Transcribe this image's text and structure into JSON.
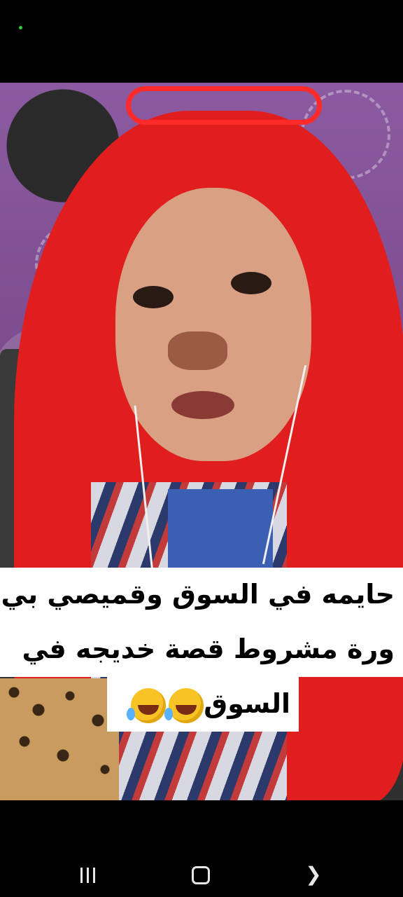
{
  "caption": {
    "line1": "حايمه في السوق وقميصي بي",
    "line2": "ورة مشروط قصة خديجه في",
    "line3": "السوق",
    "emoji": "rolling-on-floor-laughing",
    "emoji_count": 2
  },
  "nav": {
    "recents_icon": "recents-icon",
    "home_icon": "home-icon",
    "back_icon": "back-icon"
  },
  "colors": {
    "status_dot": "#2ecc40",
    "caption_bg": "#ffffff",
    "scarf": "#e01e1e"
  }
}
